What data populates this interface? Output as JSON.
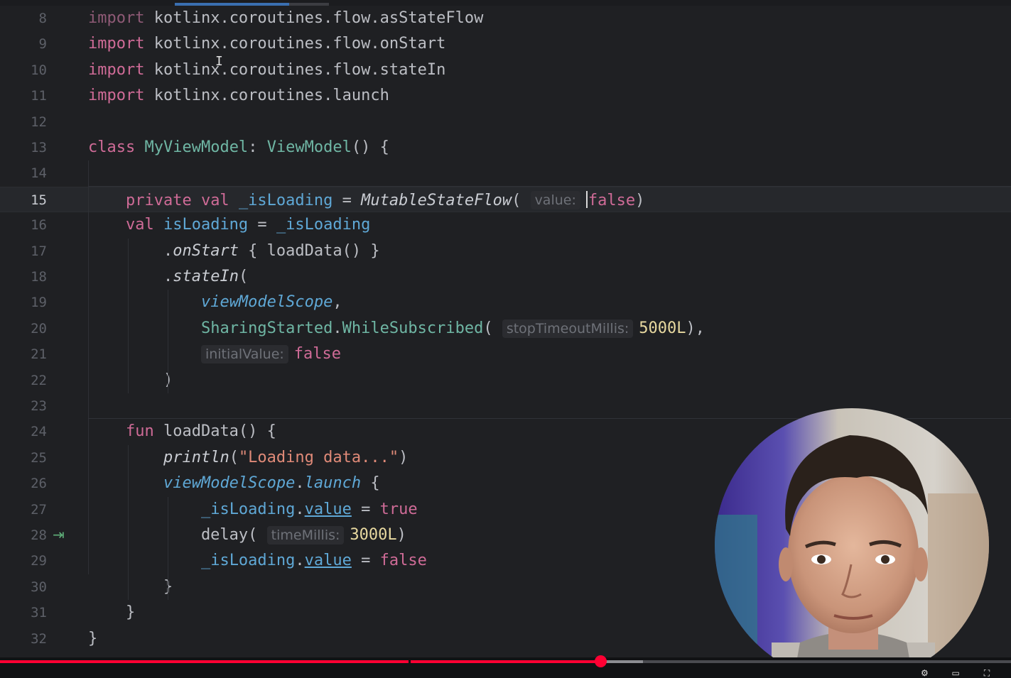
{
  "editor": {
    "current_line": 15,
    "lines": [
      {
        "no": "8",
        "tokens": [
          [
            "kw",
            "import"
          ],
          [
            "plain",
            " kotlinx.coroutines.flow.asStateFlow"
          ]
        ],
        "dim": true
      },
      {
        "no": "9",
        "tokens": [
          [
            "kw",
            "import"
          ],
          [
            "plain",
            " kotlinx.coroutines.flow.onStart"
          ]
        ]
      },
      {
        "no": "10",
        "tokens": [
          [
            "kw",
            "import"
          ],
          [
            "plain",
            " kotlinx.coroutines.flow.stateIn"
          ]
        ]
      },
      {
        "no": "11",
        "tokens": [
          [
            "kw",
            "import"
          ],
          [
            "plain",
            " kotlinx.coroutines.launch"
          ]
        ]
      },
      {
        "no": "12",
        "tokens": []
      },
      {
        "no": "13",
        "tokens": [
          [
            "kw",
            "class "
          ],
          [
            "cls",
            "MyViewModel"
          ],
          [
            "plain",
            ": "
          ],
          [
            "cls",
            "ViewModel"
          ],
          [
            "plain",
            "() {"
          ]
        ]
      },
      {
        "no": "14",
        "tokens": []
      },
      {
        "no": "15",
        "tokens": [
          [
            "plain",
            "    "
          ],
          [
            "kw",
            "private val "
          ],
          [
            "prop",
            "_isLoading"
          ],
          [
            "plain",
            " = "
          ],
          [
            "fn-it",
            "MutableStateFlow"
          ],
          [
            "plain",
            "( "
          ],
          [
            "hint",
            "value:"
          ],
          [
            "caret",
            ""
          ],
          [
            "kw",
            "false"
          ],
          [
            "plain",
            ")"
          ]
        ]
      },
      {
        "no": "16",
        "tokens": [
          [
            "plain",
            "    "
          ],
          [
            "kw",
            "val "
          ],
          [
            "prop",
            "isLoading"
          ],
          [
            "plain",
            " = "
          ],
          [
            "prop",
            "_isLoading"
          ]
        ]
      },
      {
        "no": "17",
        "tokens": [
          [
            "plain",
            "        ."
          ],
          [
            "fn-it",
            "onStart"
          ],
          [
            "plain",
            " { loadData() }"
          ]
        ]
      },
      {
        "no": "18",
        "tokens": [
          [
            "plain",
            "        ."
          ],
          [
            "fn-it",
            "stateIn"
          ],
          [
            "plain",
            "("
          ]
        ]
      },
      {
        "no": "19",
        "tokens": [
          [
            "plain",
            "            "
          ],
          [
            "prop-it",
            "viewModelScope"
          ],
          [
            "plain",
            ","
          ]
        ]
      },
      {
        "no": "20",
        "tokens": [
          [
            "plain",
            "            "
          ],
          [
            "cls",
            "SharingStarted"
          ],
          [
            "plain",
            "."
          ],
          [
            "cls",
            "WhileSubscribed"
          ],
          [
            "plain",
            "( "
          ],
          [
            "hint",
            "stopTimeoutMillis:"
          ],
          [
            "num",
            "5000L"
          ],
          [
            "plain",
            "),"
          ]
        ]
      },
      {
        "no": "21",
        "tokens": [
          [
            "plain",
            "            "
          ],
          [
            "hint",
            "initialValue:"
          ],
          [
            "kw",
            "false"
          ]
        ]
      },
      {
        "no": "22",
        "tokens": [
          [
            "plain",
            "        )"
          ]
        ]
      },
      {
        "no": "23",
        "tokens": []
      },
      {
        "no": "24",
        "tokens": [
          [
            "plain",
            "    "
          ],
          [
            "kw",
            "fun "
          ],
          [
            "plain",
            "loadData() {"
          ]
        ]
      },
      {
        "no": "25",
        "tokens": [
          [
            "plain",
            "        "
          ],
          [
            "fn-it",
            "println"
          ],
          [
            "plain",
            "("
          ],
          [
            "str",
            "\"Loading data...\""
          ],
          [
            "plain",
            ")"
          ]
        ]
      },
      {
        "no": "26",
        "tokens": [
          [
            "plain",
            "        "
          ],
          [
            "prop-it",
            "viewModelScope"
          ],
          [
            "plain",
            "."
          ],
          [
            "prop-it",
            "launch"
          ],
          [
            "plain",
            " {"
          ]
        ]
      },
      {
        "no": "27",
        "tokens": [
          [
            "plain",
            "            "
          ],
          [
            "prop",
            "_isLoading"
          ],
          [
            "plain",
            "."
          ],
          [
            "prop-u",
            "value"
          ],
          [
            "plain",
            " = "
          ],
          [
            "kw",
            "true"
          ]
        ]
      },
      {
        "no": "28",
        "tokens": [
          [
            "plain",
            "            delay( "
          ],
          [
            "hint",
            "timeMillis:"
          ],
          [
            "num",
            "3000L"
          ],
          [
            "plain",
            ")"
          ]
        ],
        "gutter_icon": "suspend-call-icon"
      },
      {
        "no": "29",
        "tokens": [
          [
            "plain",
            "            "
          ],
          [
            "prop",
            "_isLoading"
          ],
          [
            "plain",
            "."
          ],
          [
            "prop-u",
            "value"
          ],
          [
            "plain",
            " = "
          ],
          [
            "kw",
            "false"
          ]
        ]
      },
      {
        "no": "30",
        "tokens": [
          [
            "plain",
            "        }"
          ]
        ]
      },
      {
        "no": "31",
        "tokens": [
          [
            "plain",
            "    }"
          ]
        ]
      },
      {
        "no": "32",
        "tokens": [
          [
            "plain",
            "}"
          ]
        ]
      }
    ]
  },
  "video_player": {
    "progress_fraction": 0.594,
    "buffered_fraction": 0.636,
    "chapter_marker_fraction": 0.404,
    "played_color": "#ff0033"
  },
  "colors": {
    "background": "#1f2023",
    "keyword": "#cf6b97",
    "class": "#6fb6a4",
    "property": "#5fa8d6",
    "string": "#e08a78",
    "number": "#e8d9a0"
  }
}
